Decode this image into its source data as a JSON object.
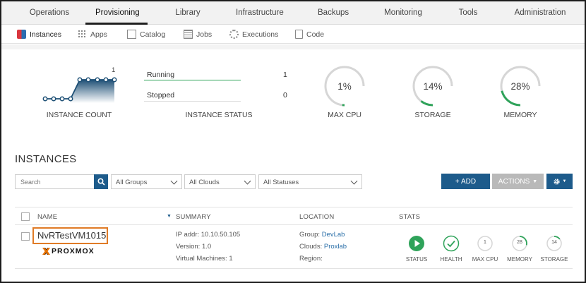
{
  "top_nav": [
    "Operations",
    "Provisioning",
    "Library",
    "Infrastructure",
    "Backups",
    "Monitoring",
    "Tools",
    "Administration"
  ],
  "sub_nav": [
    "Instances",
    "Apps",
    "Catalog",
    "Jobs",
    "Executions",
    "Code"
  ],
  "stats": {
    "instance_count": {
      "value": "1",
      "label": "INSTANCE COUNT"
    },
    "instance_status": {
      "label": "INSTANCE STATUS",
      "running_label": "Running",
      "running_count": "1",
      "stopped_label": "Stopped",
      "stopped_count": "0"
    },
    "cpu": {
      "value": "1%",
      "label": "MAX CPU",
      "fraction": 0.01
    },
    "storage": {
      "value": "14%",
      "label": "STORAGE",
      "fraction": 0.14
    },
    "memory": {
      "value": "28%",
      "label": "MEMORY",
      "fraction": 0.28
    }
  },
  "instances": {
    "title": "INSTANCES",
    "search_placeholder": "Search",
    "filters": [
      "All Groups",
      "All Clouds",
      "All Statuses"
    ],
    "add_label": "+ ADD",
    "actions_label": "ACTIONS",
    "columns": {
      "name": "NAME",
      "summary": "SUMMARY",
      "location": "LOCATION",
      "stats": "STATS"
    },
    "row": {
      "name": "NvRTestVM1015",
      "provider": "PROXMOX",
      "summary": [
        "IP addr: 10.10.50.105",
        "Version: 1.0",
        "Virtual Machines: 1"
      ],
      "group_label": "Group:",
      "group": "DevLab",
      "clouds_label": "Clouds:",
      "clouds": "Proxlab",
      "region_label": "Region:",
      "stats": {
        "status_label": "STATUS",
        "health_label": "HEALTH",
        "cpu_value": "1",
        "cpu_label": "MAX CPU",
        "memory_value": "28",
        "memory_label": "MEMORY",
        "storage_value": "14",
        "storage_label": "STORAGE"
      }
    }
  },
  "colors": {
    "accent": "#1d5b8b",
    "green": "#2fa35a",
    "gauge_track": "#d6d6d6",
    "highlight": "#e07b26"
  }
}
